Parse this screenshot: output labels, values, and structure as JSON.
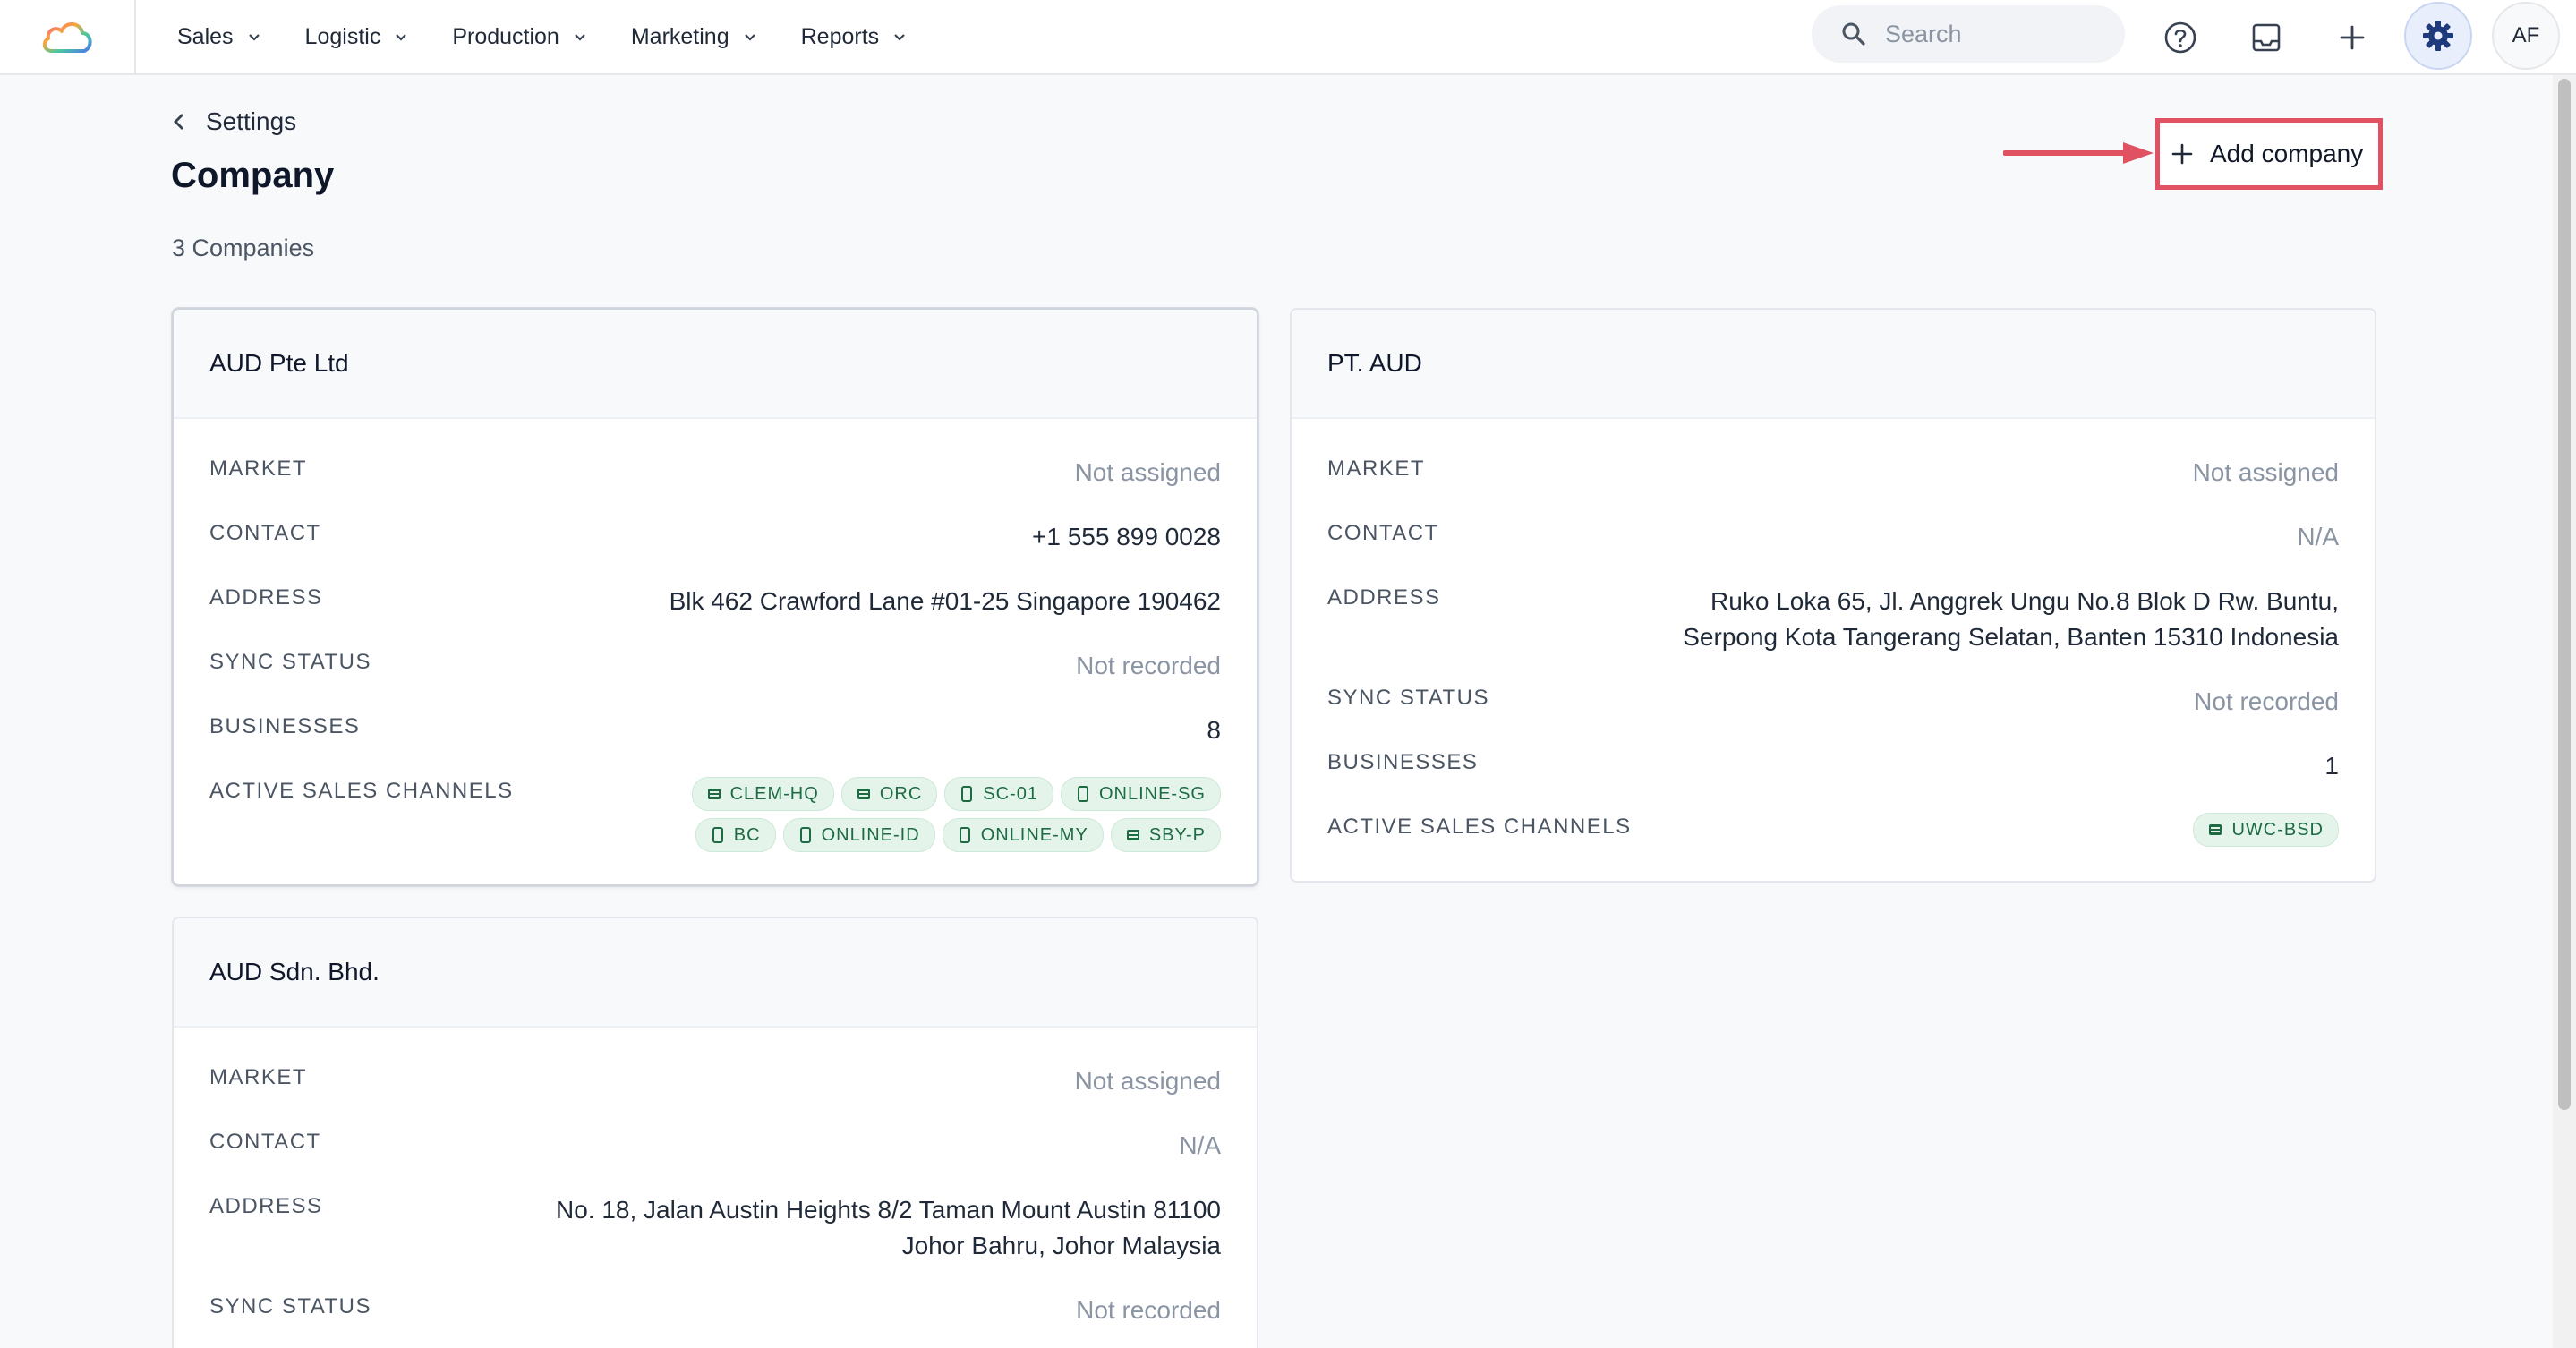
{
  "nav": {
    "items": [
      {
        "label": "Sales"
      },
      {
        "label": "Logistic"
      },
      {
        "label": "Production"
      },
      {
        "label": "Marketing"
      },
      {
        "label": "Reports"
      }
    ],
    "search_placeholder": "Search",
    "avatar_initials": "AF"
  },
  "header": {
    "back_label": "Settings",
    "title": "Company",
    "count": "3 Companies",
    "add_button": "Add company"
  },
  "labels": {
    "market": "MARKET",
    "contact": "CONTACT",
    "address": "ADDRESS",
    "sync_status": "SYNC STATUS",
    "businesses": "BUSINESSES",
    "channels": "ACTIVE SALES CHANNELS"
  },
  "companies": [
    {
      "name": "AUD Pte Ltd",
      "market": "Not assigned",
      "contact": "+1 555 899 0028",
      "address_line1": "Blk 462 Crawford Lane #01-25 Singapore 190462",
      "address_line2": "",
      "sync_status": "Not recorded",
      "businesses": "8",
      "channels": [
        {
          "label": "CLEM-HQ",
          "icon": "store-icon"
        },
        {
          "label": "ORC",
          "icon": "store-icon"
        },
        {
          "label": "SC-01",
          "icon": "mobile-icon"
        },
        {
          "label": "ONLINE-SG",
          "icon": "mobile-icon"
        },
        {
          "label": "BC",
          "icon": "mobile-icon"
        },
        {
          "label": "ONLINE-ID",
          "icon": "mobile-icon"
        },
        {
          "label": "ONLINE-MY",
          "icon": "mobile-icon"
        },
        {
          "label": "SBY-P",
          "icon": "store-icon"
        }
      ]
    },
    {
      "name": "PT. AUD",
      "market": "Not assigned",
      "contact": "N/A",
      "address_line1": "Ruko Loka 65, Jl. Anggrek Ungu No.8 Blok D Rw. Buntu,",
      "address_line2": "Serpong Kota Tangerang Selatan, Banten 15310 Indonesia",
      "sync_status": "Not recorded",
      "businesses": "1",
      "channels": [
        {
          "label": "UWC-BSD",
          "icon": "store-icon"
        }
      ]
    },
    {
      "name": "AUD Sdn. Bhd.",
      "market": "Not assigned",
      "contact": "N/A",
      "address_line1": "No. 18, Jalan Austin Heights 8/2 Taman Mount Austin 81100",
      "address_line2": "Johor Bahru, Johor Malaysia",
      "sync_status": "Not recorded"
    }
  ],
  "colors": {
    "highlight": "#e05262",
    "chip_bg": "#e4f4ea",
    "chip_text": "#1e6b43",
    "settings_icon": "#1e3a7b"
  }
}
